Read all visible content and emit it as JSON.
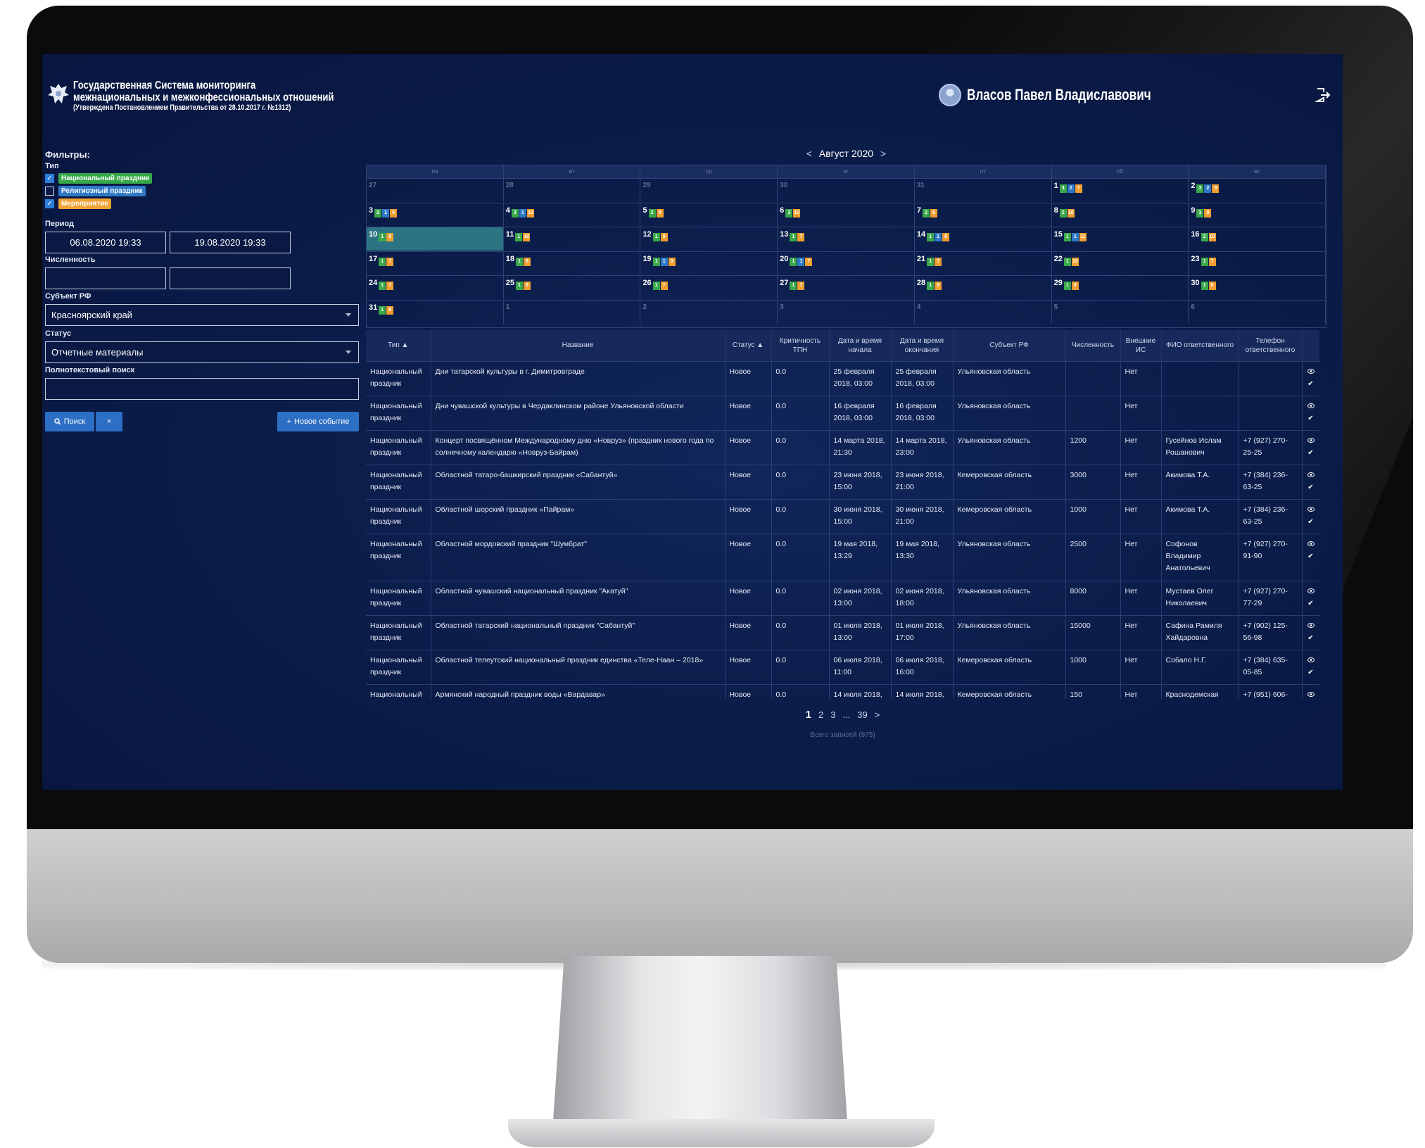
{
  "header": {
    "title_line1": "Государственная Система мониторинга",
    "title_line2": "межнациональных и межконфессиональных отношений",
    "title_line3": "(Утверждена Постановлением Правительства от 28.10.2017 г. №1312)",
    "user_name": "Власов Павел Владиславович",
    "icons": {
      "emblem": "coat-of-arms-icon",
      "avatar": "user-avatar-icon",
      "logout": "logout-icon"
    }
  },
  "filters": {
    "title": "Фильтры:",
    "type_label": "Тип",
    "types": [
      {
        "label": "Национальный праздник",
        "checked": true,
        "color": "#37a84a"
      },
      {
        "label": "Религиозный праздник",
        "checked": false,
        "color": "#2f79c6"
      },
      {
        "label": "Мероприятие",
        "checked": true,
        "color": "#f0a232"
      }
    ],
    "period_label": "Период",
    "period_from": "06.08.2020 19:33",
    "period_to": "19.08.2020 19:33",
    "count_label": "Численность",
    "count_from": "",
    "count_to": "",
    "region_label": "Субъект РФ",
    "region_value": "Красноярский край",
    "status_label": "Статус",
    "status_value": "Отчетные материалы",
    "fulltext_label": "Полнотекстовый поиск",
    "fulltext_value": "",
    "search_button": "Поиск",
    "clear_button": "×",
    "new_event_button": "Новое событие"
  },
  "calendar": {
    "month": "Август 2020",
    "prev": "<",
    "next": ">",
    "weekdays": [
      "пн",
      "вт",
      "ср",
      "чт",
      "пт",
      "сб",
      "вс"
    ],
    "weeks": [
      [
        {
          "d": "27",
          "dim": true,
          "b": []
        },
        {
          "d": "28",
          "dim": true,
          "b": []
        },
        {
          "d": "29",
          "dim": true,
          "b": []
        },
        {
          "d": "30",
          "dim": true,
          "b": []
        },
        {
          "d": "31",
          "dim": true,
          "b": []
        },
        {
          "d": "1",
          "b": [
            [
              "g",
              "3"
            ],
            [
              "b",
              "2"
            ],
            [
              "o",
              "7"
            ]
          ]
        },
        {
          "d": "2",
          "b": [
            [
              "g",
              "3"
            ],
            [
              "b",
              "2"
            ],
            [
              "o",
              "9"
            ]
          ]
        }
      ],
      [
        {
          "d": "3",
          "b": [
            [
              "g",
              "2"
            ],
            [
              "b",
              "1"
            ],
            [
              "o",
              "9"
            ]
          ]
        },
        {
          "d": "4",
          "b": [
            [
              "g",
              "3"
            ],
            [
              "b",
              "1"
            ],
            [
              "o",
              "10"
            ]
          ]
        },
        {
          "d": "5",
          "b": [
            [
              "g",
              "2"
            ],
            [
              "o",
              "9"
            ]
          ]
        },
        {
          "d": "6",
          "b": [
            [
              "g",
              "3"
            ],
            [
              "o",
              "10"
            ]
          ]
        },
        {
          "d": "7",
          "b": [
            [
              "g",
              "2"
            ],
            [
              "o",
              "9"
            ]
          ]
        },
        {
          "d": "8",
          "b": [
            [
              "g",
              "2"
            ],
            [
              "o",
              "10"
            ]
          ]
        },
        {
          "d": "9",
          "b": [
            [
              "g",
              "3"
            ],
            [
              "o",
              "9"
            ]
          ]
        }
      ],
      [
        {
          "d": "10",
          "sel": true,
          "b": [
            [
              "g",
              "1"
            ],
            [
              "o",
              "8"
            ]
          ]
        },
        {
          "d": "11",
          "b": [
            [
              "g",
              "1"
            ],
            [
              "o",
              "10"
            ]
          ]
        },
        {
          "d": "12",
          "b": [
            [
              "g",
              "1"
            ],
            [
              "o",
              "9"
            ]
          ]
        },
        {
          "d": "13",
          "b": [
            [
              "g",
              "1"
            ],
            [
              "o",
              "7"
            ]
          ]
        },
        {
          "d": "14",
          "b": [
            [
              "g",
              "1"
            ],
            [
              "b",
              "1"
            ],
            [
              "o",
              "8"
            ]
          ]
        },
        {
          "d": "15",
          "b": [
            [
              "g",
              "1"
            ],
            [
              "b",
              "1"
            ],
            [
              "o",
              "11"
            ]
          ]
        },
        {
          "d": "16",
          "b": [
            [
              "g",
              "2"
            ],
            [
              "o",
              "10"
            ]
          ]
        }
      ],
      [
        {
          "d": "17",
          "b": [
            [
              "g",
              "1"
            ],
            [
              "o",
              "7"
            ]
          ]
        },
        {
          "d": "18",
          "b": [
            [
              "g",
              "1"
            ],
            [
              "o",
              "6"
            ]
          ]
        },
        {
          "d": "19",
          "b": [
            [
              "g",
              "1"
            ],
            [
              "b",
              "1"
            ],
            [
              "o",
              "9"
            ]
          ]
        },
        {
          "d": "20",
          "b": [
            [
              "g",
              "1"
            ],
            [
              "b",
              "1"
            ],
            [
              "o",
              "7"
            ]
          ]
        },
        {
          "d": "21",
          "b": [
            [
              "g",
              "1"
            ],
            [
              "o",
              "7"
            ]
          ]
        },
        {
          "d": "22",
          "b": [
            [
              "g",
              "1"
            ],
            [
              "o",
              "10"
            ]
          ]
        },
        {
          "d": "23",
          "b": [
            [
              "g",
              "1"
            ],
            [
              "o",
              "7"
            ]
          ]
        }
      ],
      [
        {
          "d": "24",
          "b": [
            [
              "g",
              "1"
            ],
            [
              "o",
              "7"
            ]
          ]
        },
        {
          "d": "25",
          "b": [
            [
              "g",
              "1"
            ],
            [
              "o",
              "8"
            ]
          ]
        },
        {
          "d": "26",
          "b": [
            [
              "g",
              "1"
            ],
            [
              "o",
              "7"
            ]
          ]
        },
        {
          "d": "27",
          "b": [
            [
              "g",
              "1"
            ],
            [
              "o",
              "7"
            ]
          ]
        },
        {
          "d": "28",
          "b": [
            [
              "g",
              "1"
            ],
            [
              "o",
              "8"
            ]
          ]
        },
        {
          "d": "29",
          "b": [
            [
              "g",
              "1"
            ],
            [
              "o",
              "9"
            ]
          ]
        },
        {
          "d": "30",
          "b": [
            [
              "g",
              "1"
            ],
            [
              "o",
              "8"
            ]
          ]
        }
      ],
      [
        {
          "d": "31",
          "b": [
            [
              "g",
              "1"
            ],
            [
              "o",
              "8"
            ]
          ]
        },
        {
          "d": "1",
          "dim": true,
          "b": []
        },
        {
          "d": "2",
          "dim": true,
          "b": []
        },
        {
          "d": "3",
          "dim": true,
          "b": []
        },
        {
          "d": "4",
          "dim": true,
          "b": []
        },
        {
          "d": "5",
          "dim": true,
          "b": []
        },
        {
          "d": "6",
          "dim": true,
          "b": []
        }
      ]
    ]
  },
  "table": {
    "columns": [
      "Тип ▲",
      "Название",
      "Статус ▲",
      "Критичность ТПН",
      "Дата и время начала",
      "Дата и время окончания",
      "Субъект РФ",
      "Численность",
      "Внешние ИС",
      "ФИО ответственного",
      "Телефон ответственного",
      ""
    ],
    "rows": [
      {
        "type": "Национальный праздник",
        "name": "Дни татарской культуры в г. Димитровграде",
        "status": "Новое",
        "crit": "0.0",
        "start": "25 февраля 2018, 03:00",
        "end": "25 февраля 2018, 03:00",
        "region": "Ульяновская область",
        "count": "",
        "ext": "Нет",
        "fio": "",
        "phone": ""
      },
      {
        "type": "Национальный праздник",
        "name": "Дни чувашской культуры в Чердаклинском районе Ульяновской области",
        "status": "Новое",
        "crit": "0.0",
        "start": "16 февраля 2018, 03:00",
        "end": "16 февраля 2018, 03:00",
        "region": "Ульяновская область",
        "count": "",
        "ext": "Нет",
        "fio": "",
        "phone": ""
      },
      {
        "type": "Национальный праздник",
        "name": "Концерт посвящённом Международному дню «Новруз» (праздник нового года по солнечному календарю «Новруз-Байрам)",
        "status": "Новое",
        "crit": "0.0",
        "start": "14 марта 2018, 21:30",
        "end": "14 марта 2018, 23:00",
        "region": "Ульяновская область",
        "count": "1200",
        "ext": "Нет",
        "fio": "Гусейнов Ислам Рошанович",
        "phone": "+7 (927) 270-25-25"
      },
      {
        "type": "Национальный праздник",
        "name": "Областной татаро-башкирский праздник «Сабантуй»",
        "status": "Новое",
        "crit": "0.0",
        "start": "23 июня 2018, 15:00",
        "end": "23 июня 2018, 21:00",
        "region": "Кемеровская область",
        "count": "3000",
        "ext": "Нет",
        "fio": "Акимова Т.А.",
        "phone": "+7 (384) 236-63-25"
      },
      {
        "type": "Национальный праздник",
        "name": "Областной шорский праздник «Пайрам»",
        "status": "Новое",
        "crit": "0.0",
        "start": "30 июня 2018, 15:00",
        "end": "30 июня 2018, 21:00",
        "region": "Кемеровская область",
        "count": "1000",
        "ext": "Нет",
        "fio": "Акимова Т.А.",
        "phone": "+7 (384) 236-63-25"
      },
      {
        "type": "Национальный праздник",
        "name": "Областной мордовский праздник \"Шумбрат\"",
        "status": "Новое",
        "crit": "0.0",
        "start": "19 мая 2018, 13:29",
        "end": "19 мая 2018, 13:30",
        "region": "Ульяновская область",
        "count": "2500",
        "ext": "Нет",
        "fio": "Софонов Владимир Анатольевич",
        "phone": "+7 (927) 270-91-90",
        "tall": true
      },
      {
        "type": "Национальный праздник",
        "name": "Областной чувашский национальный праздник \"Акатуй\"",
        "status": "Новое",
        "crit": "0.0",
        "start": "02 июня 2018, 13:00",
        "end": "02 июня 2018, 18:00",
        "region": "Ульяновская область",
        "count": "8000",
        "ext": "Нет",
        "fio": "Мустаев Олег Николаевич",
        "phone": "+7 (927) 270-77-29"
      },
      {
        "type": "Национальный праздник",
        "name": "Областной татарский национальный праздник \"Сабантуй\"",
        "status": "Новое",
        "crit": "0.0",
        "start": "01 июля 2018, 13:00",
        "end": "01 июля 2018, 17:00",
        "region": "Ульяновская область",
        "count": "15000",
        "ext": "Нет",
        "fio": "Сафина Рамиля Хайдаровна",
        "phone": "+7 (902) 125-56-98"
      },
      {
        "type": "Национальный праздник",
        "name": "Областной телеутский национальный праздник единства «Теле-Наан – 2018»",
        "status": "Новое",
        "crit": "0.0",
        "start": "06 июля 2018, 11:00",
        "end": "06 июля 2018, 16:00",
        "region": "Кемеровская область",
        "count": "1000",
        "ext": "Нет",
        "fio": "Собало Н.Г.",
        "phone": "+7 (384) 635-05-85"
      },
      {
        "type": "Национальный",
        "name": "Армянский народный праздник воды «Вардавар»",
        "status": "Новое",
        "crit": "0.0",
        "start": "14 июля 2018,",
        "end": "14 июля 2018,",
        "region": "Кемеровская область",
        "count": "150",
        "ext": "Нет",
        "fio": "Краснодемская",
        "phone": "+7 (951) 606-"
      }
    ],
    "row_icons": {
      "view": "eye-icon",
      "confirm": "check-icon"
    }
  },
  "pager": {
    "pages": [
      "1",
      "2",
      "3",
      "...",
      "39"
    ],
    "next": ">",
    "total": "Всего записей (975)"
  }
}
